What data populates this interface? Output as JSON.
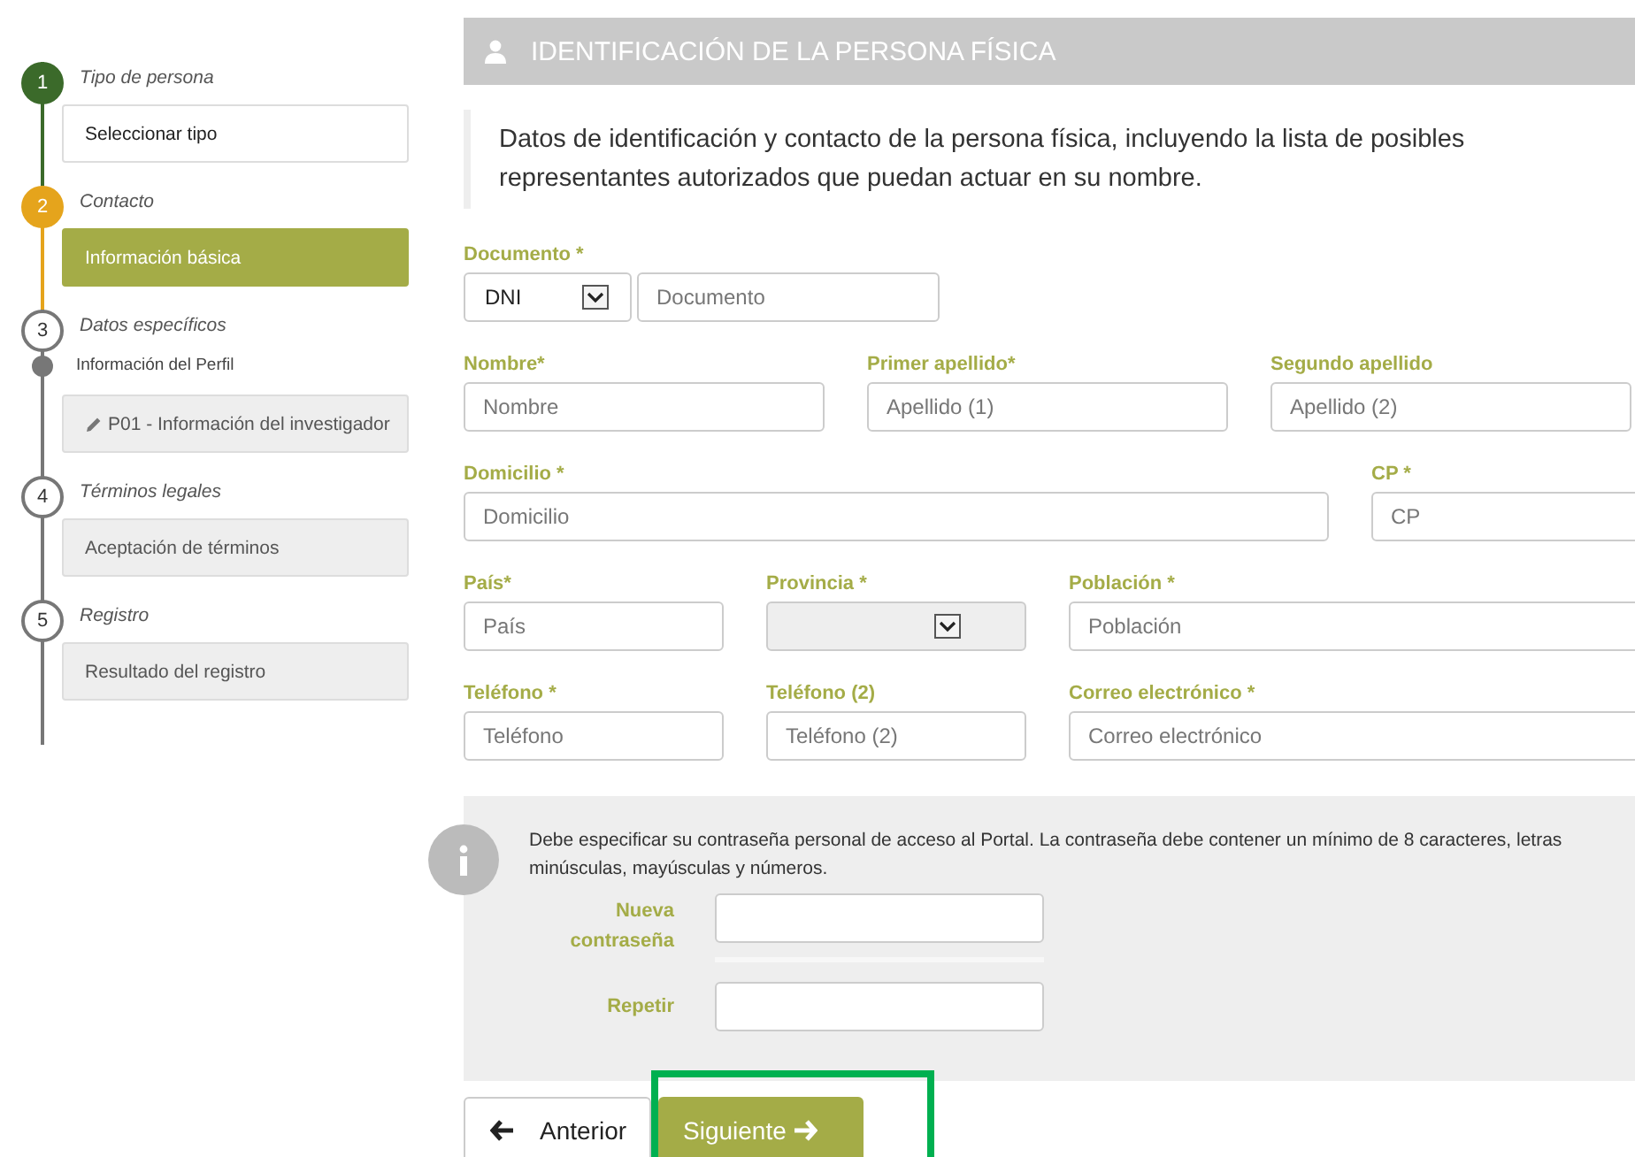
{
  "steps": [
    {
      "number": "1",
      "title": "Tipo de persona",
      "done": true,
      "current": false,
      "items": [
        {
          "kind": "button",
          "label": "Seleccionar tipo",
          "selected": false,
          "disabled": false
        }
      ]
    },
    {
      "number": "2",
      "title": "Contacto",
      "done": false,
      "current": true,
      "items": [
        {
          "kind": "button",
          "label": "Información básica",
          "selected": true,
          "disabled": false
        }
      ]
    },
    {
      "number": "3",
      "title": "Datos específicos",
      "done": false,
      "current": false,
      "items": [
        {
          "kind": "substep",
          "label": "Información del Perfil"
        },
        {
          "kind": "edit-button",
          "label": "P01 - Información del investigador",
          "selected": false,
          "disabled": true
        }
      ]
    },
    {
      "number": "4",
      "title": "Términos legales",
      "done": false,
      "current": false,
      "items": [
        {
          "kind": "button",
          "label": "Aceptación de términos",
          "selected": false,
          "disabled": true
        }
      ]
    },
    {
      "number": "5",
      "title": "Registro",
      "done": false,
      "current": false,
      "items": [
        {
          "kind": "button",
          "label": "Resultado del registro",
          "selected": false,
          "disabled": true
        }
      ]
    }
  ],
  "section": {
    "title": "IDENTIFICACIÓN DE LA PERSONA FÍSICA"
  },
  "description": "Datos de identificación y contacto de la persona física, incluyendo la lista de posibles representantes autorizados que puedan actuar en su nombre.",
  "form_rows": [
    [
      {
        "label": "Documento *",
        "kind": "document",
        "value": "DNI",
        "placeholder": "Documento"
      }
    ],
    [
      {
        "label": "Nombre*",
        "kind": "text",
        "placeholder": "Nombre"
      },
      {
        "label": "Primer apellido*",
        "kind": "text",
        "placeholder": "Apellido (1)"
      },
      {
        "label": "Segundo apellido",
        "kind": "text",
        "placeholder": "Apellido (2)"
      }
    ],
    [
      {
        "label": "Domicilio *",
        "kind": "text",
        "placeholder": "Domicilio"
      },
      {
        "label": "CP *",
        "kind": "text",
        "placeholder": "CP"
      }
    ],
    [
      {
        "label": "País*",
        "kind": "text",
        "placeholder": "País"
      },
      {
        "label": "Provincia *",
        "kind": "select",
        "disabled": true
      },
      {
        "label": "Población *",
        "kind": "text",
        "placeholder": "Población"
      }
    ],
    [
      {
        "label": "Teléfono *",
        "kind": "text",
        "placeholder": "Teléfono"
      },
      {
        "label": "Teléfono (2)",
        "kind": "text",
        "placeholder": "Teléfono (2)"
      },
      {
        "label": "Correo electrónico *",
        "kind": "text",
        "placeholder": "Correo electrónico"
      }
    ]
  ],
  "password": {
    "notice": "Debe especificar su contraseña personal de acceso al Portal. La contraseña debe contener un mínimo de 8 caracteres, letras minúsculas, mayúsculas y números.",
    "new_label": "Nueva contraseña",
    "strength": {
      "level": 0
    },
    "repeat_label": "Repetir"
  },
  "buttons": {
    "previous": {
      "label": "Anterior",
      "highlighted": false
    },
    "next": {
      "label": "Siguiente",
      "highlighted": true
    }
  }
}
